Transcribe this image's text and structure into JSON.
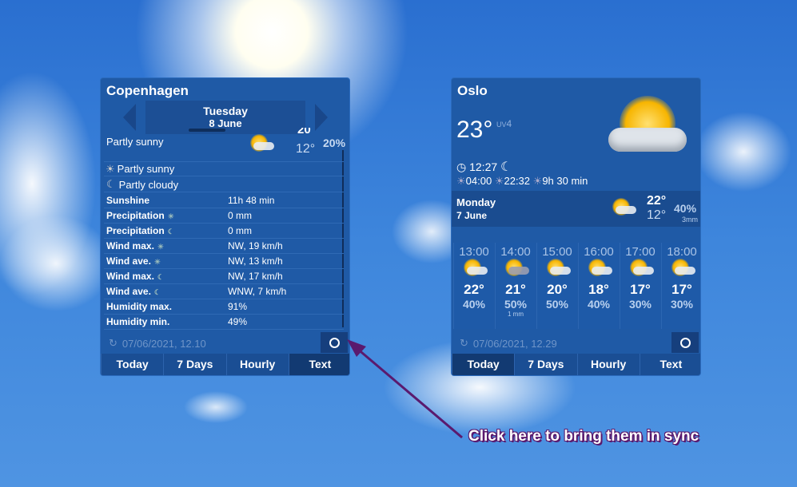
{
  "copenhagen": {
    "city": "Copenhagen",
    "day": "Tuesday",
    "date": "8 June",
    "summary": "Partly sunny",
    "high": "20",
    "low": "12°",
    "precip_chance": "20%",
    "day_condition": "Partly sunny",
    "night_condition": "Partly cloudy",
    "details": [
      {
        "label": "Sunshine",
        "value": "11h 48 min"
      },
      {
        "label": "Precipitation",
        "icon": "sun",
        "value": "0 mm"
      },
      {
        "label": "Precipitation",
        "icon": "moon",
        "value": "0 mm"
      },
      {
        "label": "Wind max.",
        "icon": "sun",
        "value": "NW, 19 km/h"
      },
      {
        "label": "Wind ave.",
        "icon": "sun",
        "value": "NW, 13 km/h"
      },
      {
        "label": "Wind max.",
        "icon": "moon",
        "value": "NW, 17 km/h"
      },
      {
        "label": "Wind ave.",
        "icon": "moon",
        "value": "WNW, 7 km/h"
      },
      {
        "label": "Humidity max.",
        "value": "91%"
      },
      {
        "label": "Humidity min.",
        "value": "49%"
      }
    ],
    "updated": "07/06/2021, 12.10"
  },
  "oslo": {
    "city": "Oslo",
    "temp": "23°",
    "uv_label": "UV",
    "uv": "4",
    "time": "12:27",
    "sunrise": "04:00",
    "sunset": "22:32",
    "daylight": "9h 30 min",
    "day": "Monday",
    "date": "7 June",
    "high": "22°",
    "low": "12°",
    "precip_chance": "40%",
    "precip_amount": "3mm",
    "hours": [
      {
        "time": "13:00",
        "temp": "22°",
        "pct": "40%",
        "mm": ""
      },
      {
        "time": "14:00",
        "temp": "21°",
        "pct": "50%",
        "mm": "1 mm"
      },
      {
        "time": "15:00",
        "temp": "20°",
        "pct": "50%",
        "mm": ""
      },
      {
        "time": "16:00",
        "temp": "18°",
        "pct": "40%",
        "mm": ""
      },
      {
        "time": "17:00",
        "temp": "17°",
        "pct": "30%",
        "mm": ""
      },
      {
        "time": "18:00",
        "temp": "17°",
        "pct": "30%",
        "mm": ""
      }
    ],
    "updated": "07/06/2021, 12.29"
  },
  "tabs": [
    "Today",
    "7 Days",
    "Hourly",
    "Text"
  ],
  "annotation": "Click here to bring them in sync",
  "colors": {
    "panel": "#1f5aa6",
    "annotation_arrow": "#5a1a6e"
  }
}
